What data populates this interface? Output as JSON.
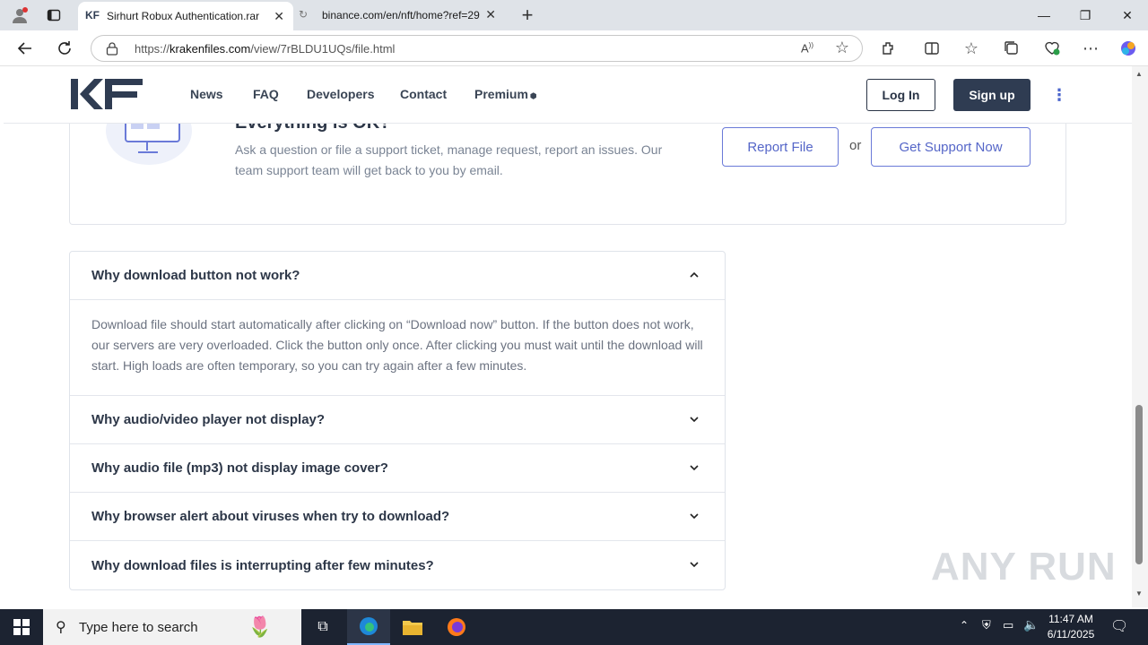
{
  "browser": {
    "tabs": [
      {
        "title": "Sirhurt Robux Authentication.rar",
        "active": true
      },
      {
        "title": "binance.com/en/nft/home?ref=29",
        "active": false
      }
    ],
    "url_prefix": "https://",
    "url_domain": "krakenfiles.com",
    "url_path": "/view/7rBLDU1UQs/file.html"
  },
  "site": {
    "logo": "KF",
    "nav": [
      "News",
      "FAQ",
      "Developers",
      "Contact",
      "Premium"
    ],
    "login_label": "Log In",
    "signup_label": "Sign up"
  },
  "support": {
    "title": "Everything is OK?",
    "text": "Ask a question or file a support ticket, manage request, report an issues. Our team support team will get back to you by email.",
    "report_label": "Report File",
    "or_label": "or",
    "support_label": "Get Support Now"
  },
  "faq": [
    {
      "q": "Why download button not work?",
      "open": true,
      "a": "Download file should start automatically after clicking on “Download now” button. If the button does not work, our servers are very overloaded. Click the button only once. After clicking you must wait until the download will start. High loads are often temporary, so you can try again after a few minutes."
    },
    {
      "q": "Why audio/video player not display?",
      "open": false
    },
    {
      "q": "Why audio file (mp3) not display image cover?",
      "open": false
    },
    {
      "q": "Why browser alert about viruses when try to download?",
      "open": false
    },
    {
      "q": "Why download files is interrupting after few minutes?",
      "open": false
    }
  ],
  "watermark": "ANY RUN",
  "taskbar": {
    "search_placeholder": "Type here to search",
    "time": "11:47 AM",
    "date": "6/11/2025"
  },
  "colors": {
    "accent": "#5566c8",
    "dark_button": "#2f3c52",
    "taskbar": "#1c2331"
  }
}
